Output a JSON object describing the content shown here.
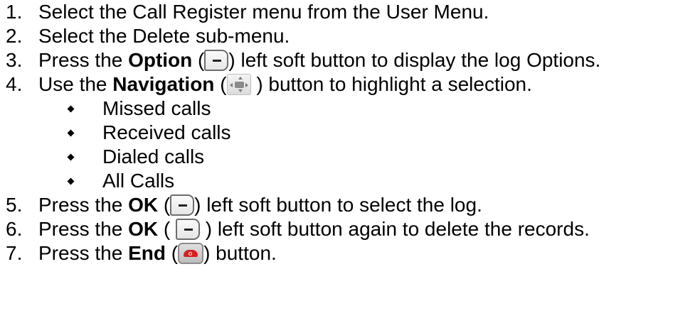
{
  "steps": [
    {
      "num": "1.",
      "text": "Select the Call Register menu from the User Menu."
    },
    {
      "num": "2.",
      "text": "Select the Delete sub-menu."
    },
    {
      "num": "3.",
      "pre": "Press the ",
      "bold": "Option",
      "post": ") left soft button to display the log Options.",
      "icon": "soft-key-icon"
    },
    {
      "num": "4.",
      "pre": "Use the ",
      "bold": "Navigation",
      "post": ") button to highlight a selection.",
      "icon": "navigation-key-icon"
    },
    {
      "num": "5.",
      "pre": "Press the ",
      "bold": "OK",
      "post": ") left soft button to select the log.",
      "icon": "soft-key-icon"
    },
    {
      "num": "6.",
      "pre": "Press the ",
      "bold": "OK",
      "post": ") left soft button again to delete the records.",
      "icon": "soft-key-icon"
    },
    {
      "num": "7.",
      "pre": "Press the ",
      "bold": "End",
      "post": ") button.",
      "icon": "end-key-icon"
    }
  ],
  "bullets": [
    "Missed calls",
    "Received calls",
    "Dialed calls",
    "All Calls"
  ],
  "open_paren": "(",
  "colors": {
    "text": "#000000",
    "end_key": "#d42020"
  }
}
